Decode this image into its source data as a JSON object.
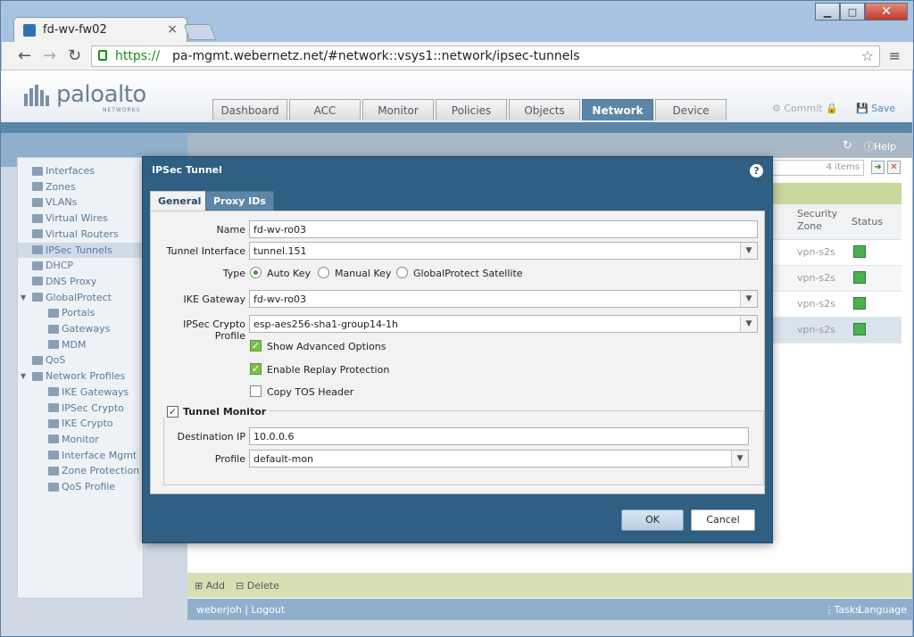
{
  "browser": {
    "tab_title": "fd-wv-fw02",
    "tab_close": "×",
    "url_https": "https://",
    "url_rest": "pa-mgmt.webernetz.net/#network::vsys1::network/ipsec-tunnels",
    "window_min": "▁",
    "window_max": "□",
    "window_close": "✕"
  },
  "app": {
    "logo_text": "paloalto",
    "logo_sub": "NETWORKS",
    "tabs": [
      "Dashboard",
      "ACC",
      "Monitor",
      "Policies",
      "Objects",
      "Network",
      "Device"
    ],
    "active_tab": "Network",
    "commit_label": "Commit",
    "save_label": "Save",
    "help_label": "Help",
    "items_count": "4 items",
    "grid_col_zone": "Security Zone",
    "grid_col_status": "Status",
    "grid_rows": [
      {
        "zone": "vpn-s2s"
      },
      {
        "zone": "vpn-s2s"
      },
      {
        "zone": "vpn-s2s"
      },
      {
        "zone": "vpn-s2s"
      }
    ],
    "footer_add": "Add",
    "footer_delete": "Delete",
    "user": "weberjoh",
    "logout": "Logout",
    "tasks": "Tasks",
    "language": "Language"
  },
  "sidebar": {
    "items": [
      {
        "label": "Interfaces",
        "level": 0
      },
      {
        "label": "Zones",
        "level": 0
      },
      {
        "label": "VLANs",
        "level": 0
      },
      {
        "label": "Virtual Wires",
        "level": 0
      },
      {
        "label": "Virtual Routers",
        "level": 0
      },
      {
        "label": "IPSec Tunnels",
        "level": 0,
        "selected": true
      },
      {
        "label": "DHCP",
        "level": 0
      },
      {
        "label": "DNS Proxy",
        "level": 0
      },
      {
        "label": "GlobalProtect",
        "level": 0,
        "expandable": true
      },
      {
        "label": "Portals",
        "level": 1
      },
      {
        "label": "Gateways",
        "level": 1
      },
      {
        "label": "MDM",
        "level": 1
      },
      {
        "label": "QoS",
        "level": 0
      },
      {
        "label": "Network Profiles",
        "level": 0,
        "expandable": true
      },
      {
        "label": "IKE Gateways",
        "level": 1
      },
      {
        "label": "IPSec Crypto",
        "level": 1
      },
      {
        "label": "IKE Crypto",
        "level": 1
      },
      {
        "label": "Monitor",
        "level": 1
      },
      {
        "label": "Interface Mgmt",
        "level": 1
      },
      {
        "label": "Zone Protection",
        "level": 1
      },
      {
        "label": "QoS Profile",
        "level": 1
      }
    ]
  },
  "dialog": {
    "title": "IPSec Tunnel",
    "tab_general": "General",
    "tab_proxy": "Proxy IDs",
    "name_label": "Name",
    "name_value": "fd-wv-ro03",
    "tunnel_if_label": "Tunnel Interface",
    "tunnel_if_value": "tunnel.151",
    "type_label": "Type",
    "type_auto": "Auto Key",
    "type_manual": "Manual Key",
    "type_gp": "GlobalProtect Satellite",
    "ike_gw_label": "IKE Gateway",
    "ike_gw_value": "fd-wv-ro03",
    "ipsec_crypto_label": "IPSec Crypto Profile",
    "ipsec_crypto_value": "esp-aes256-sha1-group14-1h",
    "show_adv": "Show Advanced Options",
    "replay": "Enable Replay Protection",
    "copy_tos": "Copy TOS Header",
    "tunnel_monitor": "Tunnel Monitor",
    "dest_ip_label": "Destination IP",
    "dest_ip_value": "10.0.0.6",
    "profile_label": "Profile",
    "profile_value": "default-mon",
    "ok": "OK",
    "cancel": "Cancel"
  },
  "colors": {
    "accent": "#5b86a8",
    "dialog_bg": "#2f5f82",
    "status_ok": "#4caf50"
  }
}
